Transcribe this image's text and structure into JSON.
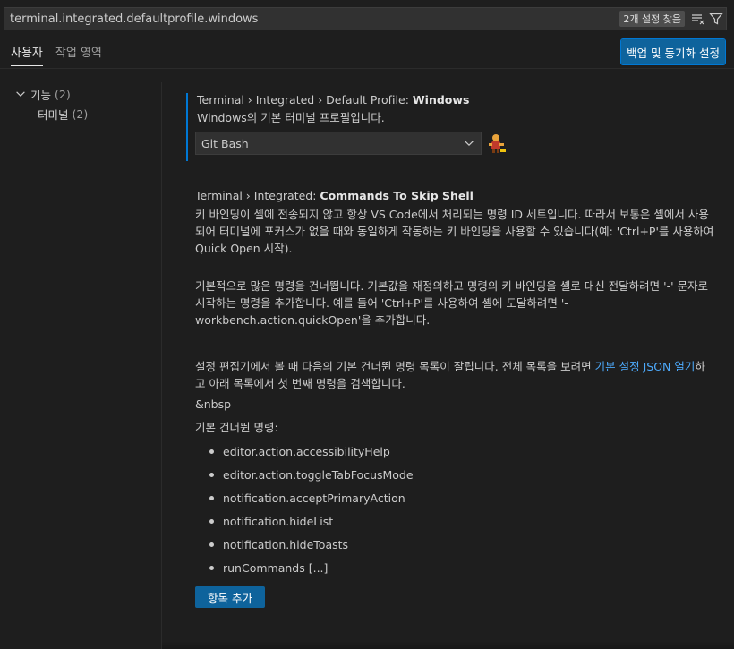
{
  "search": {
    "value": "terminal.integrated.defaultprofile.windows",
    "result_count": "2개 설정 찾음"
  },
  "tabs": [
    {
      "label": "사용자",
      "active": true
    },
    {
      "label": "작업 영역",
      "active": false
    }
  ],
  "sync_button_label": "백업 및 동기화 설정",
  "tree": {
    "parent": {
      "label": "기능",
      "count": "(2)"
    },
    "child": {
      "label": "터미널",
      "count": "(2)"
    }
  },
  "setting1": {
    "path": "Terminal › Integrated › Default Profile: ",
    "name": "Windows",
    "description": "Windows의 기본 터미널 프로필입니다.",
    "selected_value": "Git Bash"
  },
  "setting2": {
    "path": "Terminal › Integrated: ",
    "name": "Commands To Skip Shell",
    "desc1": "키 바인딩이 셸에 전송되지 않고 항상 VS Code에서 처리되는 명령 ID 세트입니다. 따라서 보통은 셸에서 사용되어 터미널에 포커스가 없을 때와 동일하게 작동하는 키 바인딩을 사용할 수 있습니다(예: 'Ctrl+P'를 사용하여 Quick Open 시작).",
    "desc2": "기본적으로 많은 명령을 건너뜁니다. 기본값을 재정의하고 명령의 키 바인딩을 셸로 대신 전달하려면 '-' 문자로 시작하는 명령을 추가합니다. 예를 들어 'Ctrl+P'를 사용하여 셸에 도달하려면 '-workbench.action.quickOpen'을 추가합니다.",
    "desc3_before": "설정 편집기에서 볼 때 다음의 기본 건너뛴 명령 목록이 잘립니다. 전체 목록을 보려면 ",
    "desc3_link": "기본 설정 JSON 열기",
    "desc3_after": "하고 아래 목록에서 첫 번째 명령을 검색합니다.",
    "nbsp_text": "&nbsp",
    "default_label": "기본 건너뛴 명령:",
    "commands": [
      "editor.action.accessibilityHelp",
      "editor.action.toggleTabFocusMode",
      "notification.acceptPrimaryAction",
      "notification.hideList",
      "notification.hideToasts",
      "runCommands [...]"
    ],
    "add_button_label": "항목 추가"
  },
  "colors": {
    "accent": "#0078d4",
    "button": "#0e639c",
    "link": "#4daafc"
  }
}
